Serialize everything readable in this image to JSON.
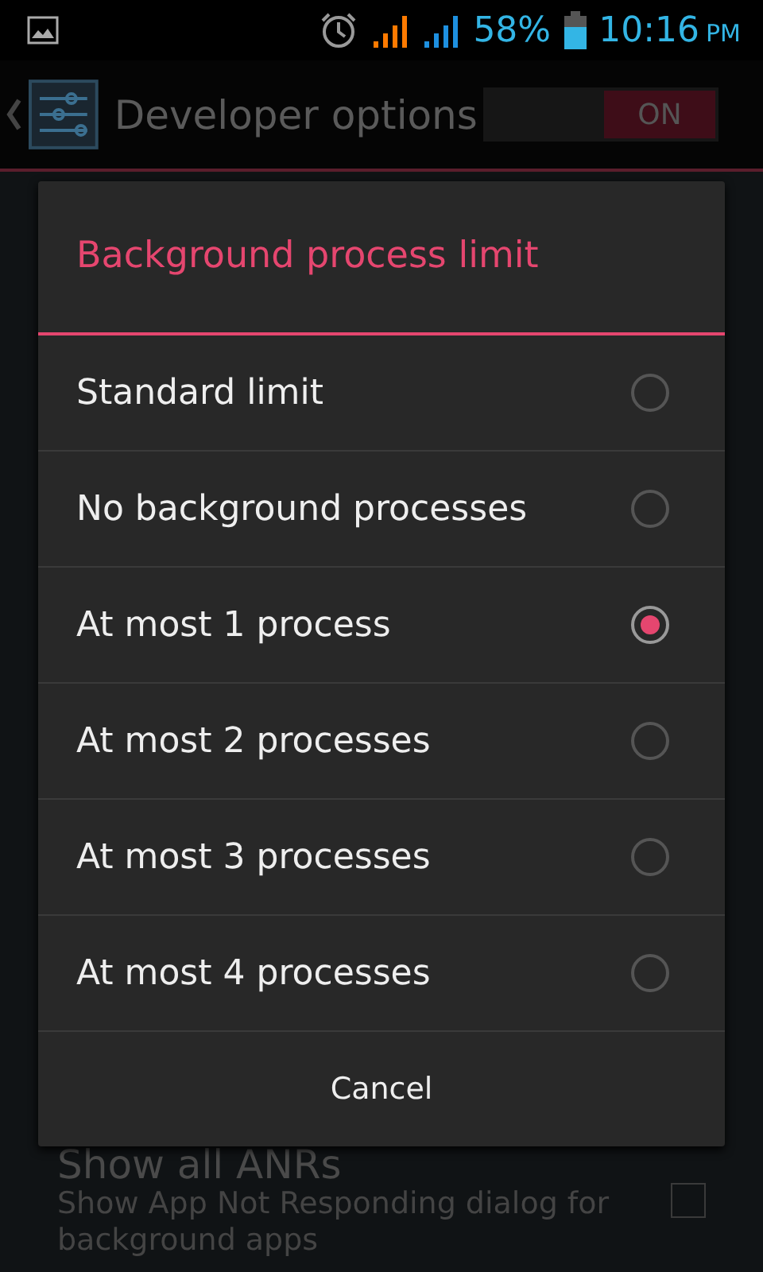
{
  "status_bar": {
    "battery": "58%",
    "time": "10:16",
    "ampm": "PM"
  },
  "action_bar": {
    "title": "Developer options",
    "switch": {
      "label": "ON",
      "on": true
    }
  },
  "settings": [
    {
      "title": "Show all ANRs",
      "summary": "Show App Not Responding dialog for background apps",
      "checked": false
    }
  ],
  "dialog": {
    "title": "Background process limit",
    "options": [
      {
        "label": "Standard limit",
        "selected": false
      },
      {
        "label": "No background processes",
        "selected": false
      },
      {
        "label": "At most 1 process",
        "selected": true
      },
      {
        "label": "At most 2 processes",
        "selected": false
      },
      {
        "label": "At most 3 processes",
        "selected": false
      },
      {
        "label": "At most 4 processes",
        "selected": false
      }
    ],
    "button": "Cancel"
  }
}
